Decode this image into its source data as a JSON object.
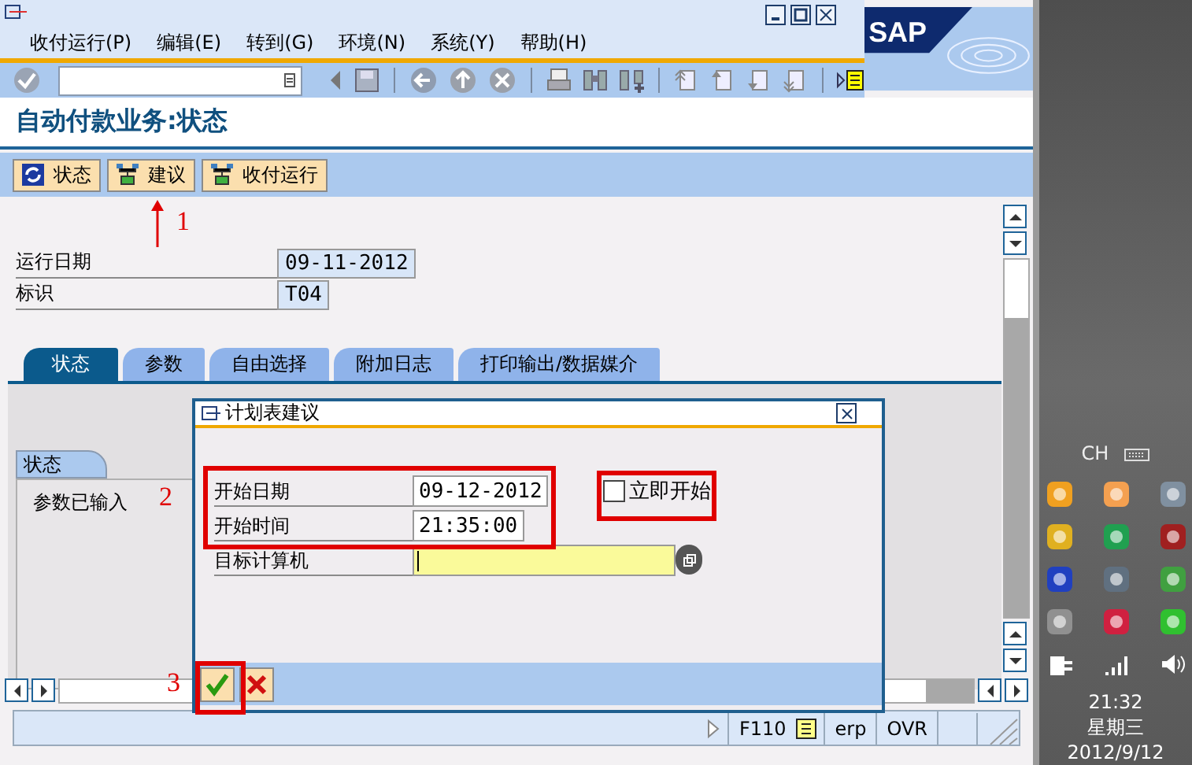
{
  "window": {
    "logo": "SAP",
    "menu": [
      "收付运行(P)",
      "编辑(E)",
      "转到(G)",
      "环境(N)",
      "系统(Y)",
      "帮助(H)"
    ]
  },
  "screen_title": "自动付款业务:状态",
  "app_toolbar": [
    {
      "kind": "refresh",
      "label": "状态"
    },
    {
      "kind": "proposal",
      "label": "建议"
    },
    {
      "kind": "proposal",
      "label": "收付运行"
    }
  ],
  "fields": [
    {
      "label": "运行日期",
      "value": "09-11-2012"
    },
    {
      "label": "标识",
      "value": "T04"
    }
  ],
  "tabs": [
    {
      "label": "状态",
      "selected": true
    },
    {
      "label": "参数",
      "selected": false
    },
    {
      "label": "自由选择",
      "selected": false
    },
    {
      "label": "附加日志",
      "selected": false
    },
    {
      "label": "打印输出/数据媒介",
      "selected": false
    }
  ],
  "status_panel": {
    "title": "状态",
    "items": [
      "参数已输入"
    ]
  },
  "dialog": {
    "title": "计划表建议",
    "fields": [
      {
        "kind": "display",
        "label": "开始日期",
        "value": "09-12-2012"
      },
      {
        "kind": "display",
        "label": "开始时间",
        "value": "21:35:00"
      },
      {
        "kind": "entry",
        "label": "目标计算机"
      }
    ],
    "checkbox": {
      "label": "立即开始",
      "checked": false
    },
    "buttons": [
      {
        "kind": "ok"
      },
      {
        "kind": "cancel"
      }
    ]
  },
  "annotations": [
    {
      "label": "1"
    },
    {
      "label": "2"
    },
    {
      "label": "3"
    }
  ],
  "status_bar": {
    "transaction": "F110",
    "system": "erp",
    "mode": "OVR"
  },
  "taskbar": {
    "language": "CH",
    "time": "21:32",
    "weekday": "星期三",
    "date": "2012/9/12"
  }
}
